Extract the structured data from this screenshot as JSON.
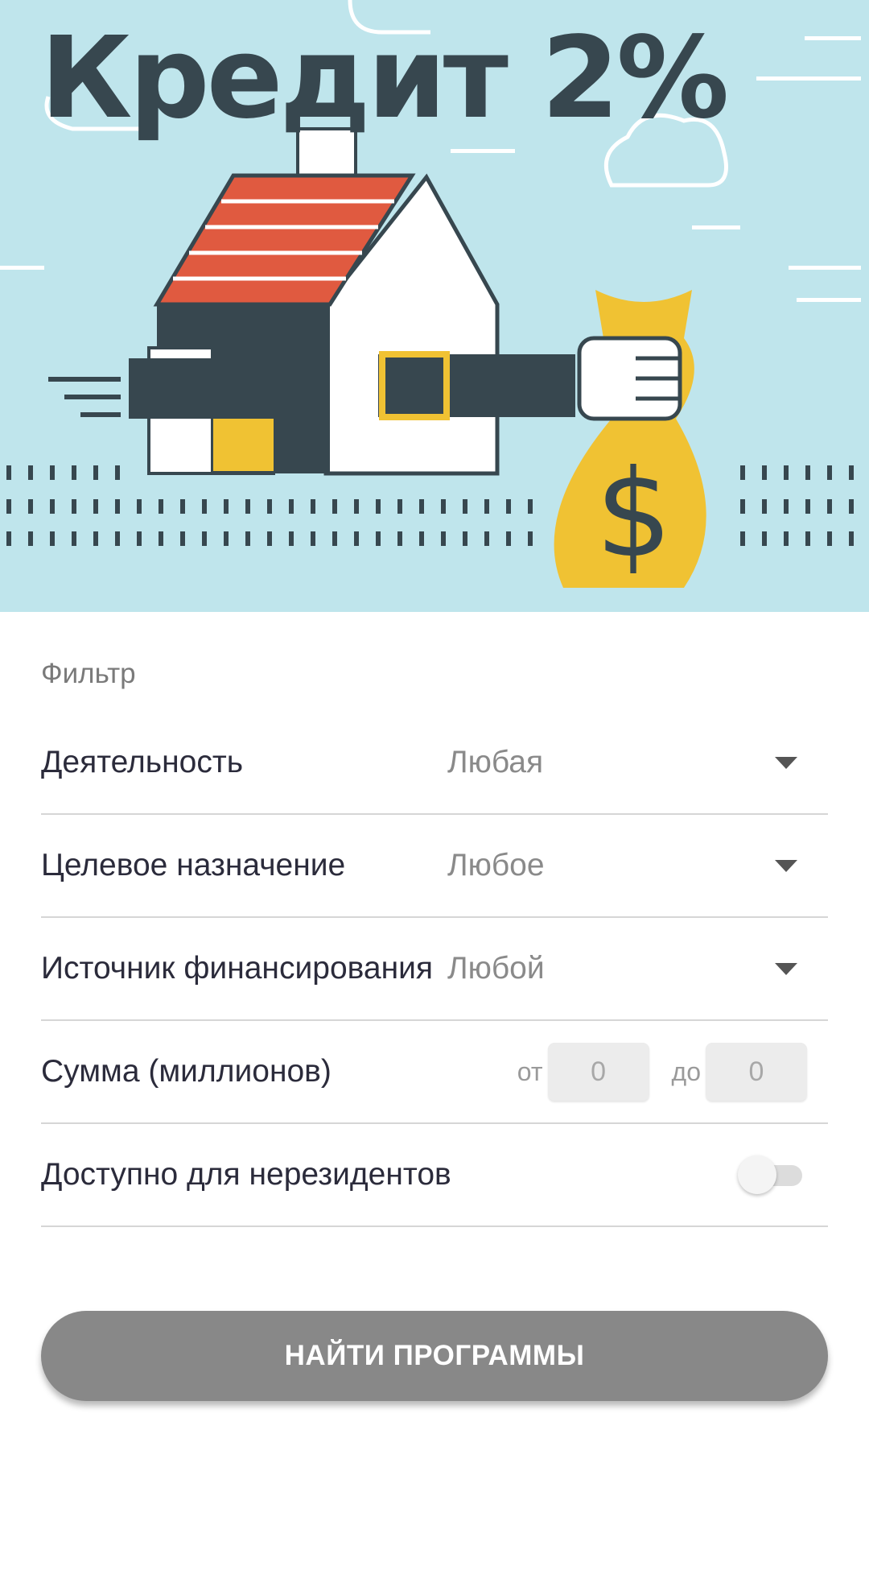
{
  "banner": {
    "title": "Кредит 2%",
    "background_color": "#bfe5ec"
  },
  "filter": {
    "title": "Фильтр",
    "rows": [
      {
        "label": "Деятельность",
        "value": "Любая"
      },
      {
        "label": "Целевое назначение",
        "value": "Любое"
      },
      {
        "label": "Источник финансирования",
        "value": "Любой"
      }
    ],
    "amount": {
      "label": "Сумма (миллионов)",
      "from_label": "от",
      "from_value": "0",
      "to_label": "до",
      "to_value": "0"
    },
    "nonresidents": {
      "label": "Доступно для нерезидентов",
      "enabled": false
    }
  },
  "actions": {
    "find_label": "НАЙТИ ПРОГРАММЫ",
    "button_color": "#888888"
  }
}
